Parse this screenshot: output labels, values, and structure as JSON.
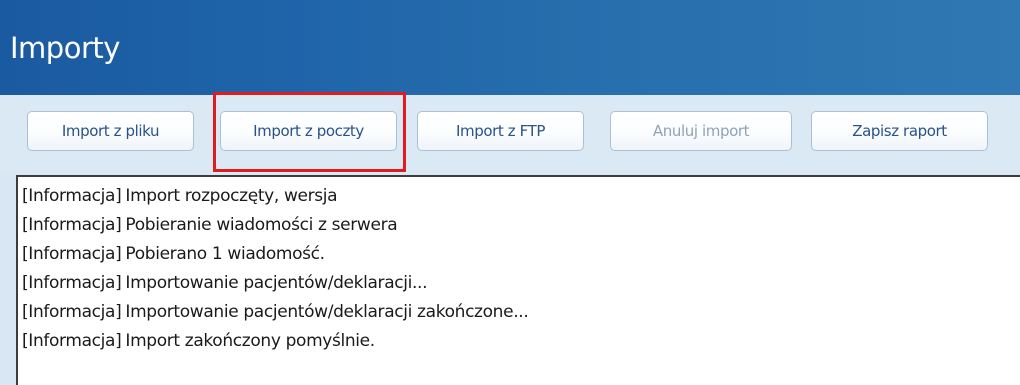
{
  "header": {
    "title": "Importy"
  },
  "toolbar": {
    "buttons": [
      {
        "label": "Import z pliku",
        "enabled": true
      },
      {
        "label": "Import z poczty",
        "enabled": true,
        "highlighted": true
      },
      {
        "label": "Import z FTP",
        "enabled": true
      },
      {
        "label": "Anuluj import",
        "enabled": false
      },
      {
        "label": "Zapisz raport",
        "enabled": true
      }
    ]
  },
  "log": {
    "lines": [
      {
        "tag": "[Informacja]",
        "message": "Import rozpoczęty, wersja"
      },
      {
        "tag": "[Informacja]",
        "message": "Pobieranie wiadomości z serwera"
      },
      {
        "tag": "[Informacja]",
        "message": "Pobierano 1 wiadomość."
      },
      {
        "tag": "[Informacja]",
        "message": "Importowanie pacjentów/deklaracji..."
      },
      {
        "tag": "[Informacja]",
        "message": "Importowanie pacjentów/deklaracji zakończone..."
      },
      {
        "tag": "[Informacja]",
        "message": "Import zakończony pomyślnie."
      }
    ]
  },
  "colors": {
    "header_bg": "#1e63a9",
    "toolbar_bg": "#dbe9f5",
    "button_text": "#27528a",
    "highlight_border": "#e11b22"
  }
}
